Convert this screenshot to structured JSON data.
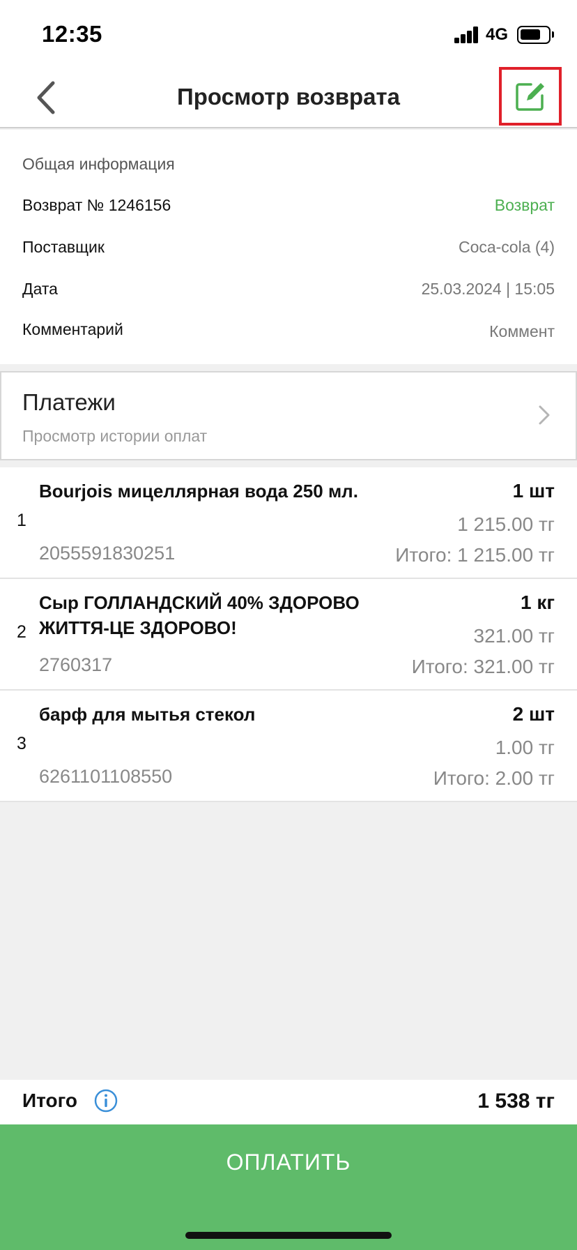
{
  "status_bar": {
    "time": "12:35",
    "network": "4G",
    "icons": [
      "signal-icon",
      "battery-icon"
    ]
  },
  "header": {
    "title": "Просмотр возврата",
    "back_icon": "chevron-left-icon",
    "edit_icon": "edit-icon",
    "accent_color": "#4caf50",
    "highlight_color": "#e0202a"
  },
  "info": {
    "caption": "Общая информация",
    "rows": [
      {
        "label": "Возврат № 1246156",
        "value": "Возврат"
      },
      {
        "label": "Поставщик",
        "value": "Coca-cola (4)"
      },
      {
        "label": "Дата",
        "value": "25.03.2024 | 15:05"
      },
      {
        "label": "Комментарий",
        "value": "Коммент"
      }
    ]
  },
  "payments": {
    "title": "Платежи",
    "subtitle": "Просмотр истории оплат",
    "icon": "chevron-right-icon"
  },
  "items": [
    {
      "index": "1",
      "name": "Bourjois  мицеллярная вода 250 мл.",
      "code": "2055591830251",
      "qty": "1 шт",
      "price": "1 215.00 тг",
      "total": "Итого: 1 215.00 тг"
    },
    {
      "index": "2",
      "name": "Сыр ГОЛЛАНДСКИЙ 40% ЗДОРОВО ЖИТТЯ-ЦЕ ЗДОРОВО!",
      "code": "2760317",
      "qty": "1 кг",
      "price": "321.00 тг",
      "total": "Итого: 321.00 тг"
    },
    {
      "index": "3",
      "name": "барф для мытья стекол",
      "code": "6261101108550",
      "qty": "2 шт",
      "price": "1.00 тг",
      "total": "Итого: 2.00 тг"
    }
  ],
  "footer": {
    "total_label": "Итого",
    "total_value": "1 538 тг",
    "info_icon": "info-icon",
    "pay_label": "ОПЛАТИТЬ",
    "pay_color": "#5fbb6a"
  }
}
